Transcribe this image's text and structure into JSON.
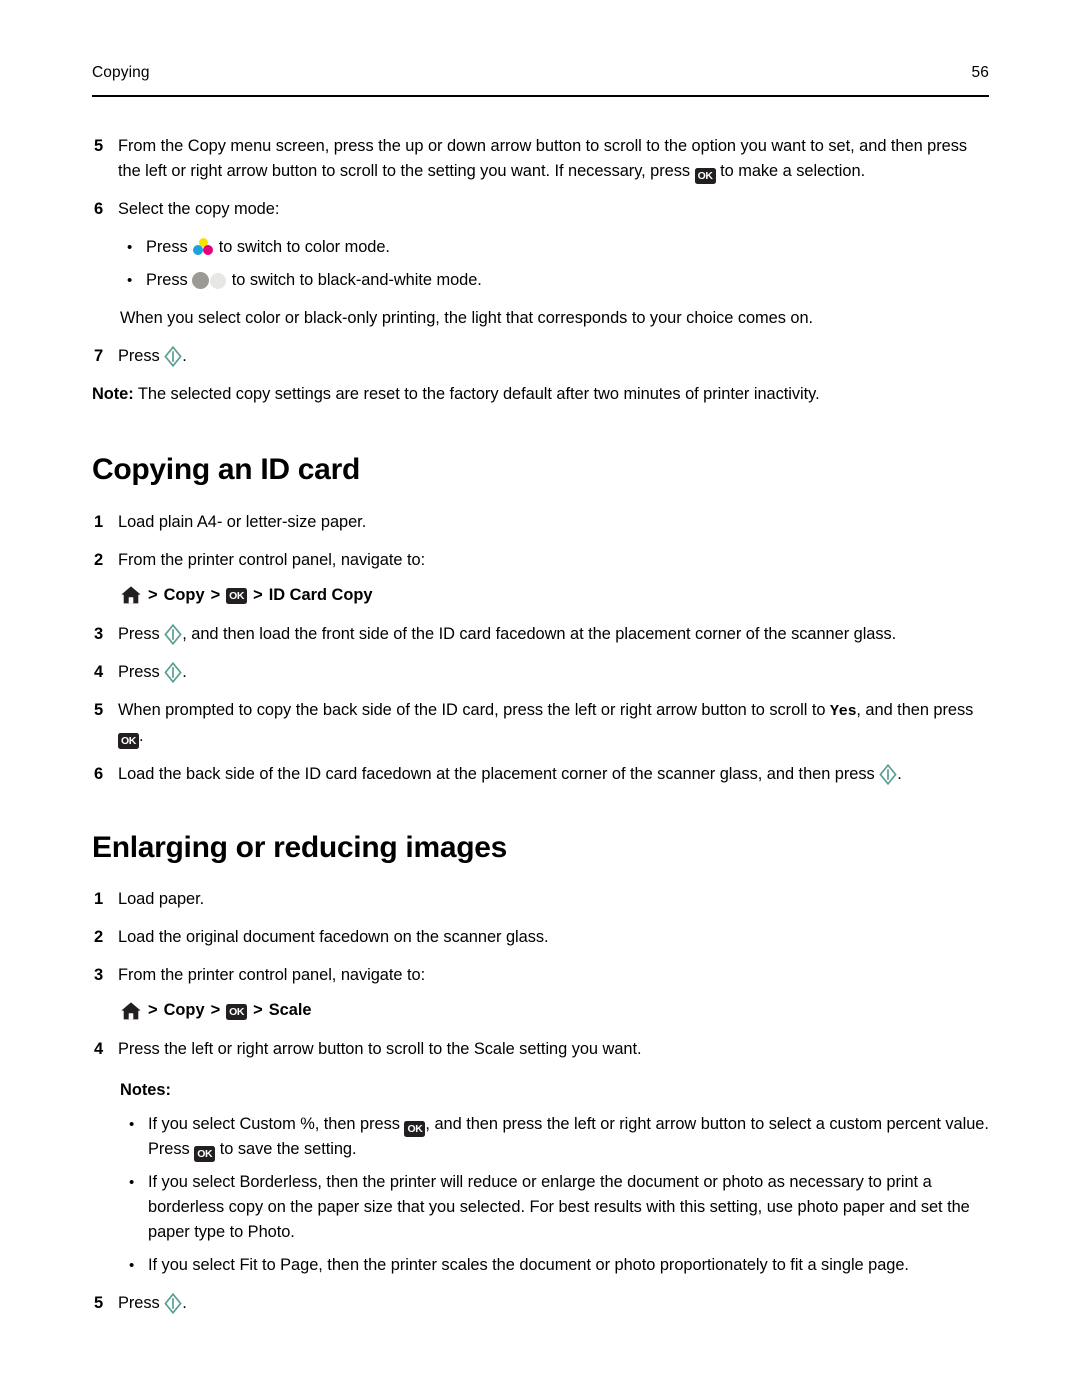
{
  "header": {
    "section_title": "Copying",
    "page_number": "56"
  },
  "icons": {
    "ok_label": "OK",
    "ok_name": "ok-button-icon",
    "start_name": "start-button-icon",
    "home_name": "home-button-icon",
    "color_name": "color-mode-icon",
    "bw_name": "black-and-white-mode-icon"
  },
  "colors": {
    "start_teal": "#5a9e93",
    "ok_dark": "#231f20",
    "cyan": "#18a3dc",
    "yellow": "#f7e200",
    "magenta": "#e6007e",
    "grey_dark": "#9b9b93",
    "grey_light": "#e7e7e4"
  },
  "copying_steps": {
    "step5_num": "5",
    "step5_part1": "From the Copy menu screen, press the up or down arrow button to scroll to the option you want to set, and then press the left or right arrow button to scroll to the setting you want. If necessary, press ",
    "step5_part2": " to make a selection.",
    "step6_num": "6",
    "step6_text": "Select the copy mode:",
    "bullet_color_part1": "Press ",
    "bullet_color_part2": " to switch to color mode.",
    "bullet_bw_part1": "Press ",
    "bullet_bw_part2": " to switch to black-and-white mode.",
    "light_paragraph": "When you select color or black-only printing, the light that corresponds to your choice comes on.",
    "step7_num": "7",
    "step7_part1": "Press ",
    "step7_part2": ".",
    "note_label": "Note:",
    "note_text": " The selected copy settings are reset to the factory default after two minutes of printer inactivity."
  },
  "id_card": {
    "heading": "Copying an ID card",
    "step1_num": "1",
    "step1_text": "Load plain A4- or letter-size paper.",
    "step2_num": "2",
    "step2_text": "From the printer control panel, navigate to:",
    "crumb": {
      "sep": ">",
      "copy": "Copy",
      "target": "ID Card Copy"
    },
    "step3_num": "3",
    "step3_part1": "Press ",
    "step3_part2": ", and then load the front side of the ID card facedown at the placement corner of the scanner glass.",
    "step4_num": "4",
    "step4_part1": "Press ",
    "step4_part2": ".",
    "step5_num": "5",
    "step5_part1": "When prompted to copy the back side of the ID card, press the left or right arrow button to scroll to ",
    "step5_value": "Yes",
    "step5_part2": ", and then press ",
    "step5_part3": ".",
    "step6_num": "6",
    "step6_part1": "Load the back side of the ID card facedown at the placement corner of the scanner glass, and then press ",
    "step6_part2": "."
  },
  "enlarging": {
    "heading": "Enlarging or reducing images",
    "step1_num": "1",
    "step1_text": "Load paper.",
    "step2_num": "2",
    "step2_text": "Load the original document facedown on the scanner glass.",
    "step3_num": "3",
    "step3_text": "From the printer control panel, navigate to:",
    "crumb": {
      "sep": ">",
      "copy": "Copy",
      "target": "Scale"
    },
    "step4_num": "4",
    "step4_text": "Press the left or right arrow button to scroll to the Scale setting you want.",
    "notes_label": "Notes:",
    "note1_part1": "If you select Custom %, then press ",
    "note1_part2": ", and then press the left or right arrow button to select a custom percent value. Press ",
    "note1_part3": " to save the setting.",
    "note2_text": "If you select Borderless, then the printer will reduce or enlarge the document or photo as necessary to print a borderless copy on the paper size that you selected. For best results with this setting, use photo paper and set the paper type to Photo.",
    "note3_text": "If you select Fit to Page, then the printer scales the document or photo proportionately to fit a single page.",
    "step5_num": "5",
    "step5_part1": "Press ",
    "step5_part2": "."
  }
}
